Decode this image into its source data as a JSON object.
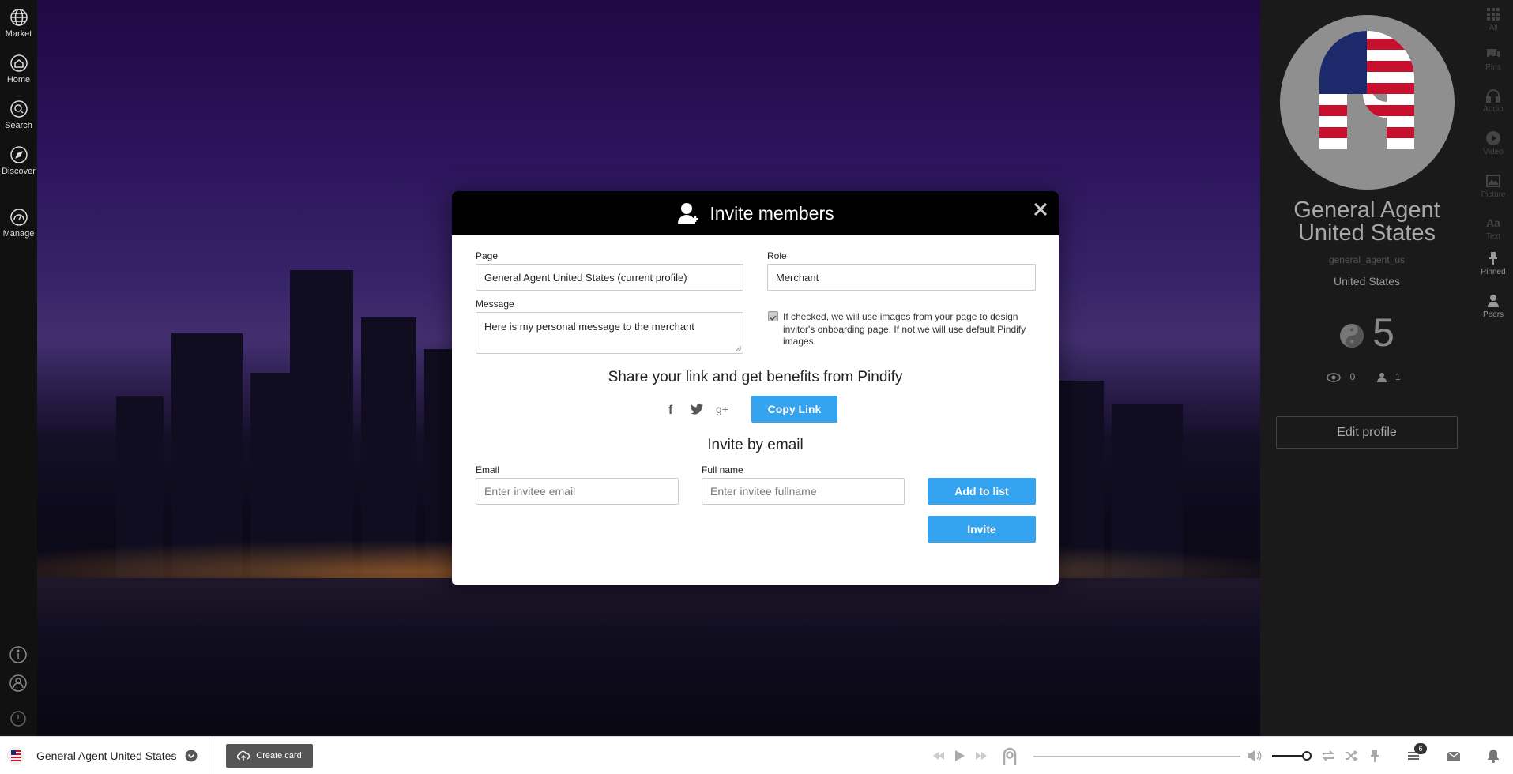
{
  "leftnav": {
    "items": [
      {
        "label": "Market",
        "icon": "globe-icon"
      },
      {
        "label": "Home",
        "icon": "home-icon"
      },
      {
        "label": "Search",
        "icon": "search-icon"
      },
      {
        "label": "Discover",
        "icon": "compass-icon"
      },
      {
        "label": "Manage",
        "icon": "gauge-icon"
      }
    ]
  },
  "dialog": {
    "title": "Invite members",
    "page_label": "Page",
    "page_value": "General Agent United States (current profile)",
    "role_label": "Role",
    "role_value": "Merchant",
    "message_label": "Message",
    "message_value": "Here is my personal message to the merchant",
    "checkbox_checked": true,
    "checkbox_text": "If checked, we will use images from your page to design invitor's onboarding page. If not we will use default Pindify images",
    "share_title": "Share your link and get benefits from Pindify",
    "copy_link": "Copy Link",
    "invite_title": "Invite by email",
    "email_label": "Email",
    "email_placeholder": "Enter invitee email",
    "fullname_label": "Full name",
    "fullname_placeholder": "Enter invitee fullname",
    "add_to_list": "Add to list",
    "invite": "Invite"
  },
  "profile": {
    "name": "General Agent United States",
    "handle": "general_agent_us",
    "country": "United States",
    "score": "5",
    "views": "0",
    "peers": "1",
    "edit_button": "Edit profile"
  },
  "rail": {
    "items": [
      {
        "label": "All",
        "icon": "grid-icon"
      },
      {
        "label": "Pins",
        "icon": "chat-icon"
      },
      {
        "label": "Audio",
        "icon": "headphones-icon"
      },
      {
        "label": "Video",
        "icon": "play-circle-icon"
      },
      {
        "label": "Picture",
        "icon": "picture-icon"
      },
      {
        "label": "Text",
        "icon": "text-icon"
      },
      {
        "label": "Pinned",
        "icon": "pin-icon"
      },
      {
        "label": "Peers",
        "icon": "person-icon"
      }
    ]
  },
  "bottombar": {
    "profile_name": "General Agent United States",
    "create_card": "Create card",
    "queue_count": "6"
  },
  "colors": {
    "accent": "#34a4f0",
    "dialog_header": "#000000",
    "panel": "#1a1a1a"
  }
}
